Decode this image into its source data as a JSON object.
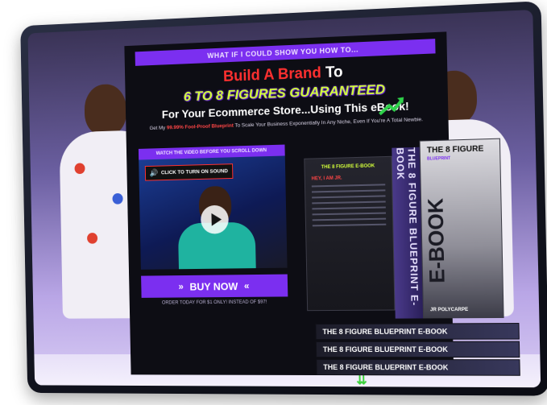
{
  "banner": {
    "text": "WHAT IF I COULD SHOW YOU HOW TO..."
  },
  "headline": {
    "line1": "Build A Brand",
    "line1_to": "To",
    "line2": "6 TO 8 FIGURES GUARANTEED",
    "line3": "For Your Ecommerce Store...Using This eBook!"
  },
  "subtext": {
    "prefix": "Get My",
    "highlight": "99.99% Fool-Proof Blueprint",
    "suffix": "To Scale Your Business Exponentially In Any Niche, Even If You're A Total Newbie."
  },
  "video": {
    "label": "WATCH THE VIDEO BEFORE YOU SCROLL DOWN",
    "sound_badge": "CLICK TO TURN ON SOUND"
  },
  "cta": {
    "buy_label": "BUY NOW",
    "note": "ORDER TODAY FOR $1 ONLY! INSTEAD OF $97!"
  },
  "ebook": {
    "page_header": "THE 8 FIGURE E-BOOK",
    "greeting": "HEY, I AM JR.",
    "spine_text": "THE 8 FIGURE BLUEPRINT E-BOOK",
    "cover_title": "THE 8 FIGURE",
    "cover_subtitle": "BLUEPRINT",
    "cover_big": "E-BOOK",
    "author": "JR POLYCARPE",
    "stack_titles": [
      "THE 8 FIGURE BLUEPRINT E-BOOK",
      "THE 8 FIGURE BLUEPRINT E-BOOK",
      "THE 8 FIGURE BLUEPRINT E-BOOK"
    ]
  },
  "colors": {
    "accent_purple": "#7b2ff0",
    "headline_red": "#ff3030",
    "neon_green": "#d3ff3b",
    "scroll_green": "#3ad13a"
  },
  "icons": [
    "speaker-icon",
    "play-icon",
    "double-chevron-right-icon",
    "double-chevron-left-icon",
    "double-chevron-down-icon",
    "trend-arrow-icon"
  ]
}
